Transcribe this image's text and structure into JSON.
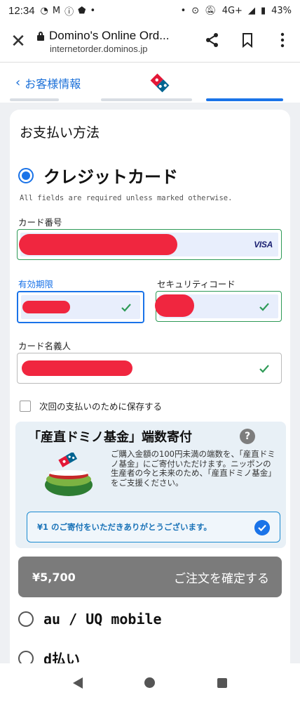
{
  "status_bar": {
    "time": "12:34",
    "network": "4G+",
    "battery": "43%"
  },
  "browser": {
    "title": "Domino's Online Ord...",
    "url": "internetorder.dominos.jp"
  },
  "header": {
    "back_label": "お客様情報"
  },
  "payment": {
    "section_title": "お支払い方法",
    "credit_card_label": "クレジットカード",
    "required_note": "All fields are required unless marked otherwise.",
    "card_number_label": "カード番号",
    "card_brand": "VISA",
    "expiry_label": "有効期限",
    "security_code_label": "セキュリティコード",
    "cardholder_label": "カード名義人",
    "save_label": "次回の支払いのために保存する"
  },
  "fund": {
    "title": "「産直ドミノ基金」端数寄付",
    "help": "?",
    "description": "ご購入金額の100円未満の端数を、「産直ドミノ基金」にご寄付いただけます。ニッポンの生産者の今と未来のため、「産直ドミノ基金」をご支援ください。",
    "donation_text": "¥1 のご寄付をいただきありがとうございます。",
    "donation_checked": true
  },
  "confirm": {
    "price": "¥5,700",
    "label": "ご注文を確定する"
  },
  "other_options": [
    {
      "label": "au / UQ mobile"
    },
    {
      "label": "d払い"
    }
  ],
  "colors": {
    "accent": "#1a73e8",
    "valid": "#2e9a57",
    "redaction": "#f0263f",
    "button": "#7b7b7b"
  }
}
